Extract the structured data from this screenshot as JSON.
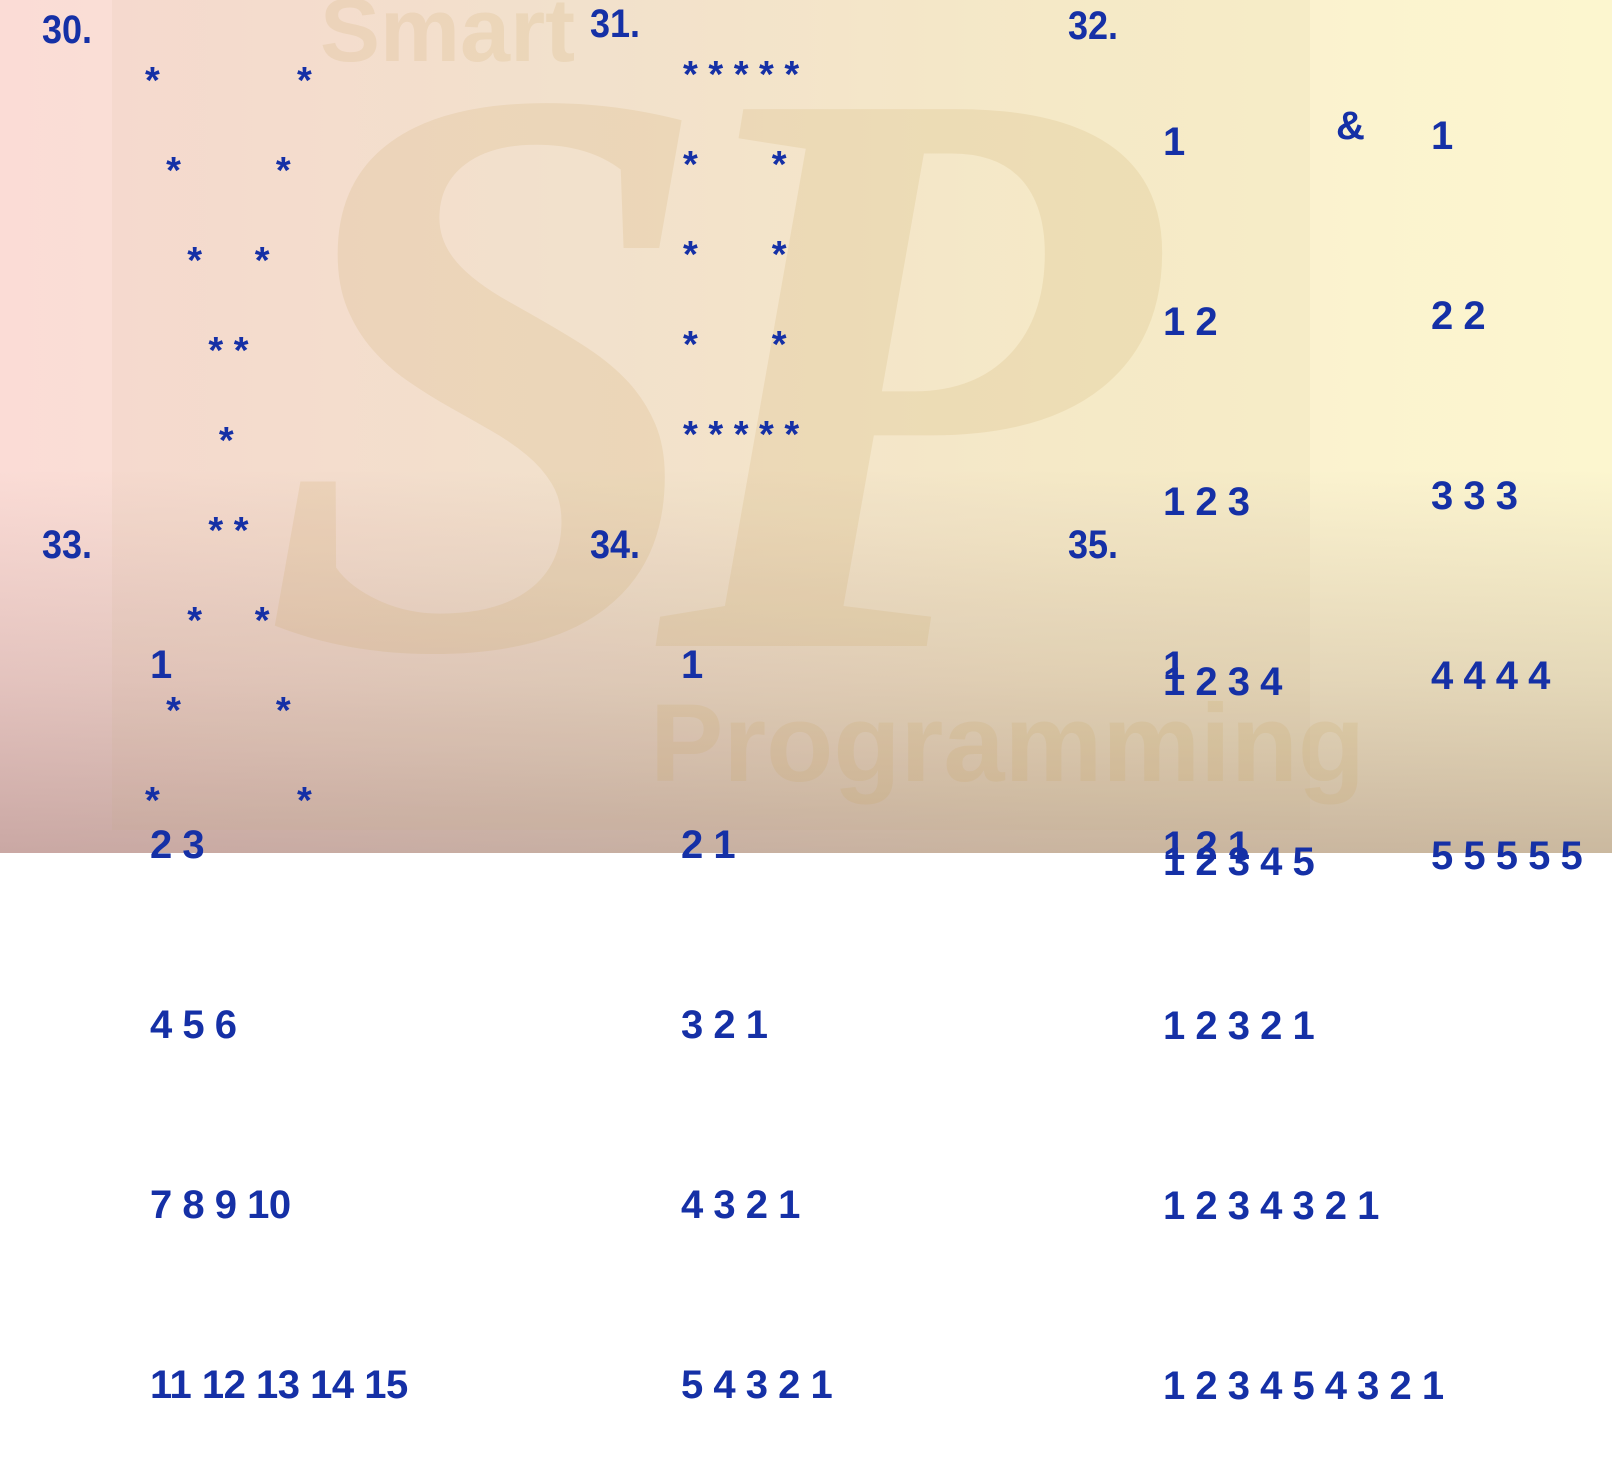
{
  "watermark": {
    "logo": "SP",
    "top_text": "Smart",
    "bottom_text": "Programming"
  },
  "colors": {
    "text": "#1530a6"
  },
  "patterns": [
    {
      "label": "30.",
      "rows": [
        "*             *",
        "  *         *",
        "    *     *",
        "      * *",
        "       *",
        "      * *",
        "    *     *",
        "  *         *",
        "*             *"
      ]
    },
    {
      "label": "31.",
      "rows": [
        "* * * * *",
        "*       *",
        "*       *",
        "*       *",
        "* * * * *"
      ]
    },
    {
      "label": "32.",
      "rows": [
        "1",
        "1 2",
        "1 2 3",
        "1 2 3 4",
        "1 2 3 4 5"
      ],
      "separator": "&",
      "rows_b": [
        "1",
        "2 2",
        "3 3 3",
        "4 4 4 4",
        "5 5 5 5 5"
      ]
    },
    {
      "label": "33.",
      "rows": [
        "1",
        "2 3",
        "4 5 6",
        "7 8 9 10",
        "11 12 13 14 15"
      ]
    },
    {
      "label": "34.",
      "rows": [
        "1",
        "2 1",
        "3 2 1",
        "4 3 2 1",
        "5 4 3 2 1"
      ]
    },
    {
      "label": "35.",
      "rows": [
        "1",
        "1 2 1",
        "1 2 3 2 1",
        "1 2 3 4 3 2 1",
        "1 2 3 4 5 4 3 2 1"
      ]
    }
  ]
}
